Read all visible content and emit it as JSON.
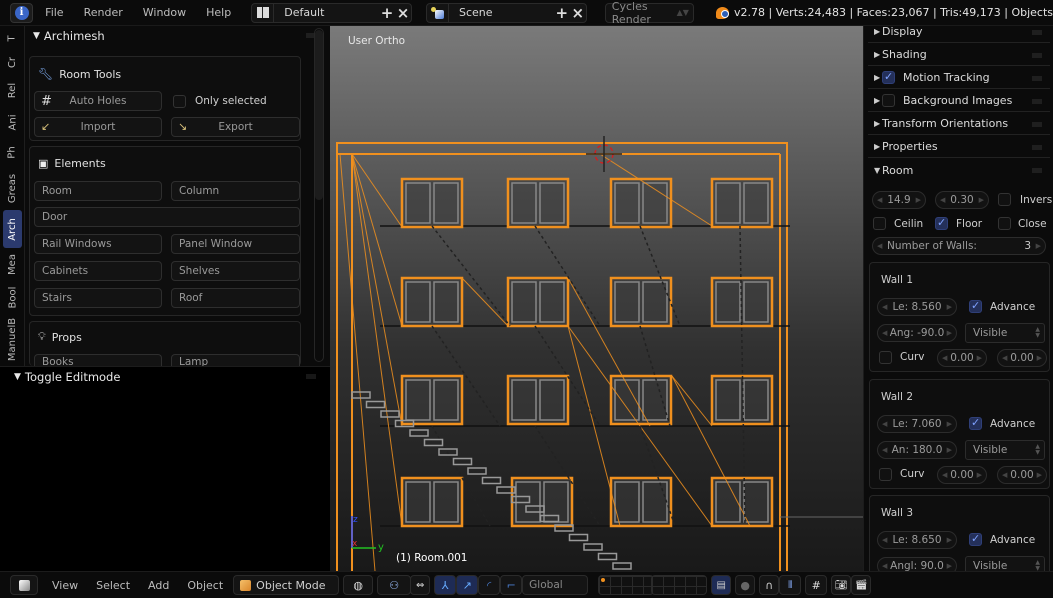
{
  "topbar": {
    "menu": [
      "File",
      "Render",
      "Window",
      "Help"
    ],
    "screen_layout": "Default",
    "scene": "Scene",
    "render_engine": "Cycles Render",
    "stats": "v2.78 | Verts:24,483 | Faces:23,067 | Tris:49,173 | Objects"
  },
  "tool_tabs": [
    "T",
    "Cr",
    "Rel",
    "Ani",
    "Ph",
    "Greas",
    "Arch",
    "Mea",
    "Bool",
    "ManuelB"
  ],
  "active_tab": "Arch",
  "archimesh": {
    "title": "Archimesh",
    "room_tools": {
      "title": "Room Tools",
      "auto_holes": "Auto Holes",
      "only_selected": "Only selected",
      "only_selected_checked": false,
      "import": "Import",
      "export": "Export"
    },
    "elements": {
      "title": "Elements",
      "buttons": [
        "Room",
        "Column",
        "Door",
        "Rail Windows",
        "Panel Window",
        "Cabinets",
        "Shelves",
        "Stairs",
        "Roof"
      ]
    },
    "props": {
      "title": "Props",
      "buttons": [
        "Books",
        "Lamp"
      ]
    }
  },
  "toggle_editmode": "Toggle Editmode",
  "viewport": {
    "view_name": "User Ortho",
    "active_object": "(1) Room.001",
    "axes": {
      "z": "z",
      "x": "x",
      "y": "y"
    }
  },
  "properties": {
    "panels": [
      {
        "label": "Display",
        "expanded": false
      },
      {
        "label": "Shading",
        "expanded": false
      },
      {
        "label": "Motion Tracking",
        "expanded": false,
        "checkbox": true
      },
      {
        "label": "Background Images",
        "expanded": false,
        "checkbox": false
      },
      {
        "label": "Transform Orientations",
        "expanded": false
      },
      {
        "label": "Properties",
        "expanded": false
      },
      {
        "label": "Room",
        "expanded": true
      }
    ],
    "room": {
      "height": "14.9",
      "thickness": "0.30",
      "invers_label": "Invers",
      "invers": false,
      "ceiling_label": "Ceilin",
      "ceiling": false,
      "floor_label": "Floor",
      "floor": true,
      "close_label": "Close",
      "close": false,
      "walls_label": "Number of Walls:",
      "walls_count": "3",
      "walls": [
        {
          "title": "Wall 1",
          "length": "Le:  8.560",
          "advance_label": "Advance",
          "advance": true,
          "angle": "Ang: -90.0",
          "visibility": "Visible",
          "curve_label": "Curv",
          "curve": false,
          "curve_a": "0.00",
          "curve_b": "0.00"
        },
        {
          "title": "Wall 2",
          "length": "Le:  7.060",
          "advance_label": "Advance",
          "advance": true,
          "angle": "An:  180.0",
          "visibility": "Visible",
          "curve_label": "Curv",
          "curve": false,
          "curve_a": "0.00",
          "curve_b": "0.00"
        },
        {
          "title": "Wall 3",
          "length": "Le:  8.650",
          "advance_label": "Advance",
          "advance": true,
          "angle": "Angl: 90.0",
          "visibility": "Visible"
        }
      ]
    }
  },
  "bottombar": {
    "menu": [
      "View",
      "Select",
      "Add",
      "Object"
    ],
    "mode": "Object Mode",
    "orientation": "Global"
  },
  "colors": {
    "selection_orange": "#f0901e",
    "active_tab": "#2b3a6e",
    "checkbox_on": "#24305a"
  }
}
